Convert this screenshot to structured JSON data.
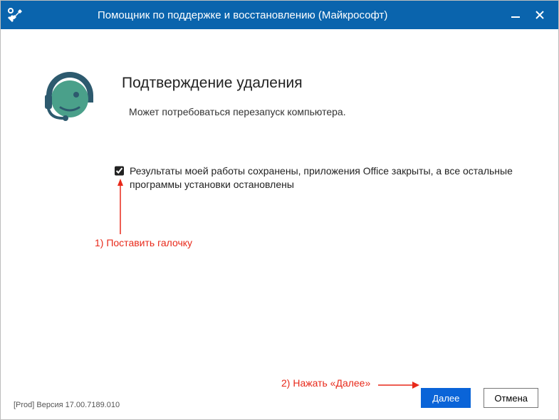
{
  "titlebar": {
    "title": "Помощник по поддержке и восстановлению (Майкрософт)"
  },
  "main": {
    "heading": "Подтверждение удаления",
    "subtext": "Может потребоваться перезапуск компьютера.",
    "checkbox_label": "Результаты моей работы сохранены, приложения Office закрыты, а все остальные программы установки остановлены"
  },
  "annotations": {
    "step1": "1) Поставить галочку",
    "step2": "2) Нажать «Далее»"
  },
  "footer": {
    "version": "[Prod] Версия 17.00.7189.010",
    "next_label": "Далее",
    "cancel_label": "Отмена"
  },
  "colors": {
    "titlebar_bg": "#0a64ad",
    "primary_button": "#0a64d8",
    "annotation": "#e8291a"
  }
}
